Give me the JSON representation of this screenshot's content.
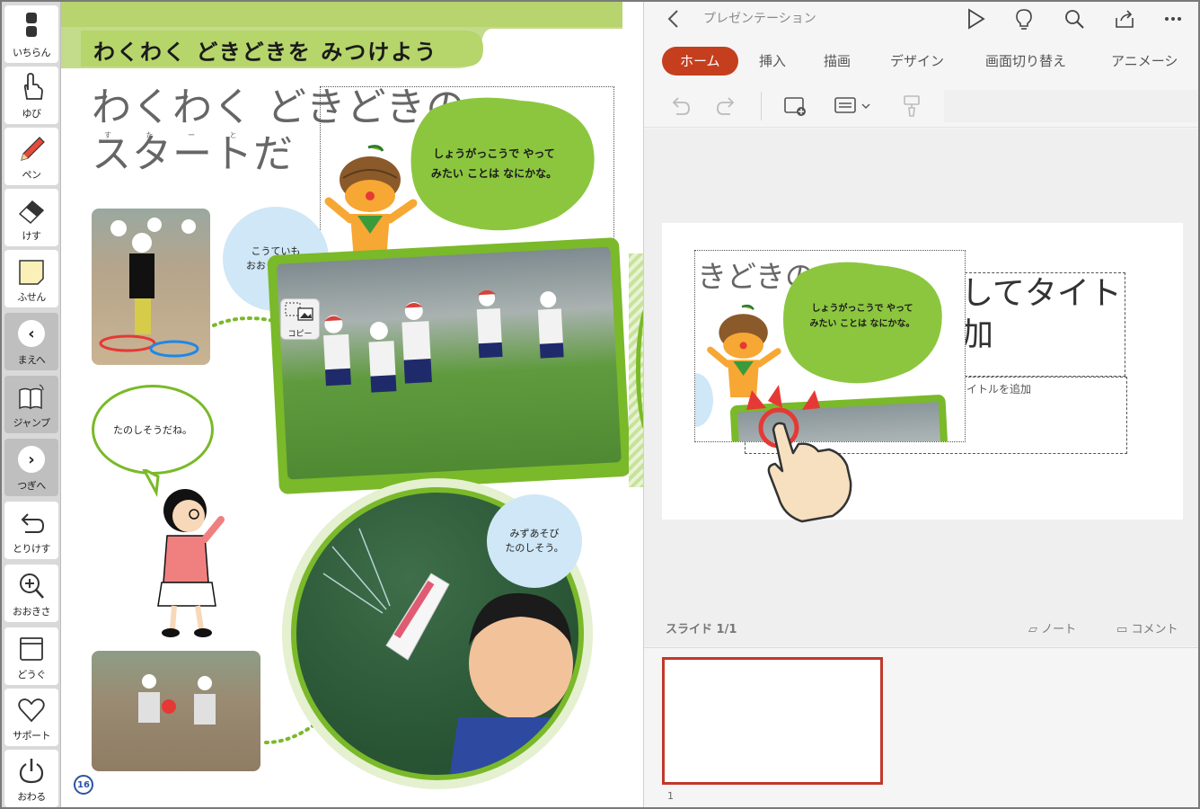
{
  "toolbar": {
    "items": [
      {
        "label": "いちらん",
        "icon": "list-icon"
      },
      {
        "label": "ゆび",
        "icon": "pointer-hand-icon"
      },
      {
        "label": "ペン",
        "icon": "pen-icon"
      },
      {
        "label": "けす",
        "icon": "eraser-icon"
      },
      {
        "label": "ふせん",
        "icon": "sticky-note-icon"
      },
      {
        "label": "まえへ",
        "icon": "chevron-left-icon"
      },
      {
        "label": "ジャンプ",
        "icon": "book-jump-icon"
      },
      {
        "label": "つぎへ",
        "icon": "chevron-right-icon"
      },
      {
        "label": "とりけす",
        "icon": "undo-icon"
      },
      {
        "label": "おおきさ",
        "icon": "zoom-in-icon"
      },
      {
        "label": "どうぐ",
        "icon": "toolbox-icon"
      },
      {
        "label": "サポート",
        "icon": "heart-icon"
      },
      {
        "label": "おわる",
        "icon": "power-icon"
      }
    ]
  },
  "book": {
    "banner": "わくわく どきどきを みつけよう",
    "headline_line1": "わくわく どきどきの",
    "headline_line2": "スタートだ",
    "ruby": "す た ー と",
    "bubbles": {
      "school": "こうていも\nおおきいね。",
      "water": "みずあそび\nたのしそう。",
      "speech": "たのしそうだね。",
      "mascot": "しょうがっこうで やって\nみたい ことは なにかな。"
    },
    "copy_label": "コピー",
    "page_number": "16"
  },
  "ppt": {
    "title": "プレゼンテーション",
    "tabs": [
      "ホーム",
      "挿入",
      "描画",
      "デザイン",
      "画面切り替え",
      "アニメーシ"
    ],
    "slide_title_fragment": "してタイト\n加",
    "subtitle_fragment": "イトルを追加",
    "pasted_heading": "きどきの",
    "pasted_bubble": "しょうがっこうで やって\nみたい ことは なにかな。",
    "slide_count": "スライド 1/1",
    "note_label": "ノート",
    "comment_label": "コメント",
    "thumb_number": "1",
    "accent": "#c53f1e"
  }
}
